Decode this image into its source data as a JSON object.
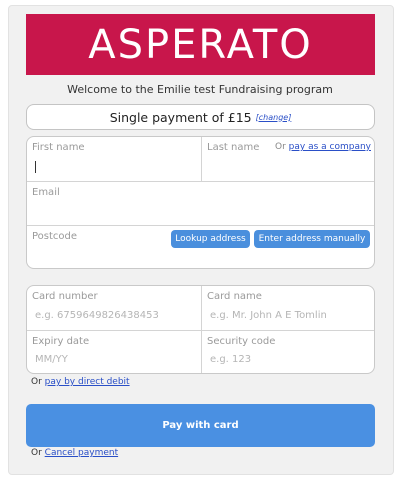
{
  "brand": {
    "logo_text": "ASPERATO",
    "color": "#c8164b"
  },
  "welcome": "Welcome to the Emilie test Fundraising program",
  "payment": {
    "summary": "Single payment of £15",
    "change_label": "[change]"
  },
  "address_form": {
    "first_name_label": "First name",
    "last_name_label": "Last name",
    "or_label": "Or",
    "company_link": "pay as a company",
    "email_label": "Email",
    "postcode_label": "Postcode",
    "lookup_button": "Lookup address",
    "manual_button": "Enter address manually"
  },
  "card_form": {
    "card_number_label": "Card number",
    "card_number_placeholder": "e.g. 6759649826438453",
    "card_name_label": "Card name",
    "card_name_placeholder": "e.g. Mr. John A E Tomlin",
    "expiry_label": "Expiry date",
    "expiry_placeholder": "MM/YY",
    "security_label": "Security code",
    "security_placeholder": "e.g. 123"
  },
  "direct_debit": {
    "or_label": "Or",
    "link": "pay by direct debit"
  },
  "pay_button": "Pay with card",
  "cancel": {
    "or_label": "Or",
    "link": "Cancel payment"
  },
  "colors": {
    "accent": "#4a90e2",
    "link": "#2a4fc7"
  }
}
